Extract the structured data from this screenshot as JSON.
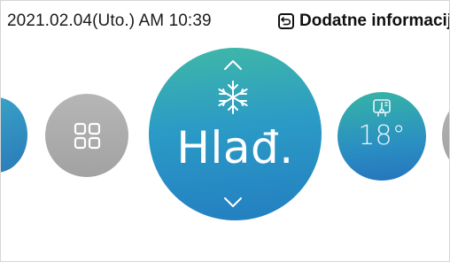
{
  "status_bar": {
    "datetime": "2021.02.04(Uto.) AM 10:39",
    "info_button_label": "Dodatne informacije"
  },
  "carousel": {
    "current_mode": "Hlađ.",
    "temperature": "18°",
    "colors": {
      "mode_gradient_top": "#3fb8a6",
      "mode_gradient_bottom": "#237ec0",
      "inactive_grey": "#a8a8a8"
    },
    "icons": [
      "back-arrow-icon",
      "grid-icon",
      "snowflake-icon",
      "chevron-up-icon",
      "chevron-down-icon",
      "thermometer-icon"
    ]
  }
}
